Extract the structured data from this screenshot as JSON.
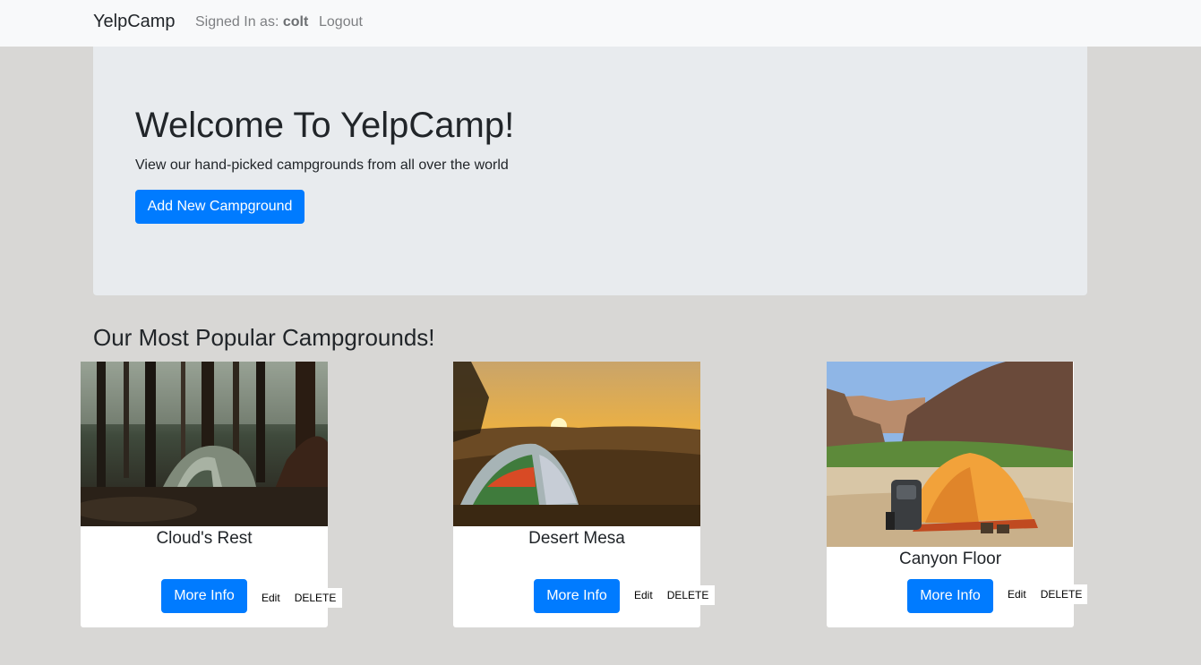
{
  "navbar": {
    "brand": "YelpCamp",
    "signed_in_prefix": "Signed In as:",
    "username": "colt",
    "logout": "Logout"
  },
  "jumbotron": {
    "title": "Welcome To YelpCamp!",
    "lead": "View our hand-picked campgrounds from all over the world",
    "add_button": "Add New Campground"
  },
  "section": {
    "title": "Our Most Popular Campgrounds!"
  },
  "campgrounds": [
    {
      "name": "Cloud's Rest",
      "more_info": "More Info",
      "edit": "Edit",
      "delete": "DELETE",
      "image": "forest-tent-image"
    },
    {
      "name": "Desert Mesa",
      "more_info": "More Info",
      "edit": "Edit",
      "delete": "DELETE",
      "image": "sunset-tent-image"
    },
    {
      "name": "Canyon Floor",
      "more_info": "More Info",
      "edit": "Edit",
      "delete": "DELETE",
      "image": "canyon-tent-image"
    }
  ],
  "colors": {
    "primary": "#007bff",
    "page_bg": "#d8d7d5",
    "navbar_bg": "#f8f9fa",
    "jumbotron_bg": "#e8ebee"
  }
}
